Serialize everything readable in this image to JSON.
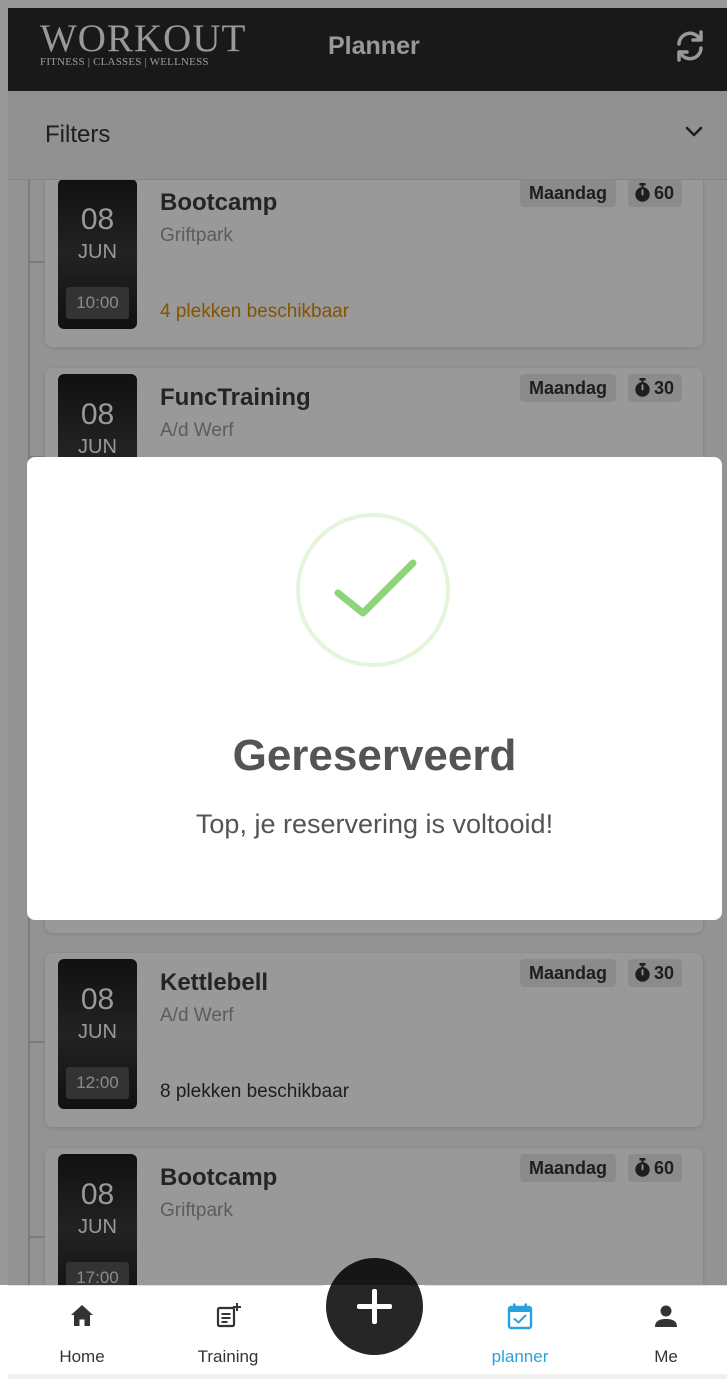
{
  "header": {
    "logo_main": "WORKOUT",
    "logo_sub": "FITNESS | CLASSES | WELLNESS",
    "title": "Planner",
    "refresh_icon": "refresh-icon"
  },
  "filters": {
    "label": "Filters",
    "icon": "chevron-down-icon"
  },
  "classes": [
    {
      "day": "08",
      "month": "JUN",
      "time": "10:00",
      "title": "Bootcamp",
      "location": "Griftpark",
      "weekday": "Maandag",
      "duration": "60",
      "availability": "4 plekken beschikbaar",
      "availability_color": "#e08a00"
    },
    {
      "day": "08",
      "month": "JUN",
      "time": "",
      "title": "FuncTraining",
      "location": "A/d Werf",
      "weekday": "Maandag",
      "duration": "30",
      "availability": ""
    },
    {
      "day": "08",
      "month": "JUN",
      "time": "12:00",
      "title": "Kettlebell",
      "location": "A/d Werf",
      "weekday": "Maandag",
      "duration": "30",
      "availability": "8 plekken beschikbaar"
    },
    {
      "day": "08",
      "month": "JUN",
      "time": "17:00",
      "title": "Bootcamp",
      "location": "Griftpark",
      "weekday": "Maandag",
      "duration": "60",
      "availability": ""
    }
  ],
  "modal": {
    "icon": "checkmark-icon",
    "title": "Gereserveerd",
    "message": "Top, je reservering is voltooid!",
    "accent_color": "#8ed47a"
  },
  "nav": {
    "items": [
      {
        "label": "Home",
        "icon": "home-icon"
      },
      {
        "label": "Training",
        "icon": "training-icon"
      },
      {
        "label": "planner",
        "icon": "calendar-icon",
        "active": true
      },
      {
        "label": "Me",
        "icon": "person-icon"
      }
    ],
    "fab_icon": "plus-icon",
    "active_color": "#29a3e0"
  }
}
